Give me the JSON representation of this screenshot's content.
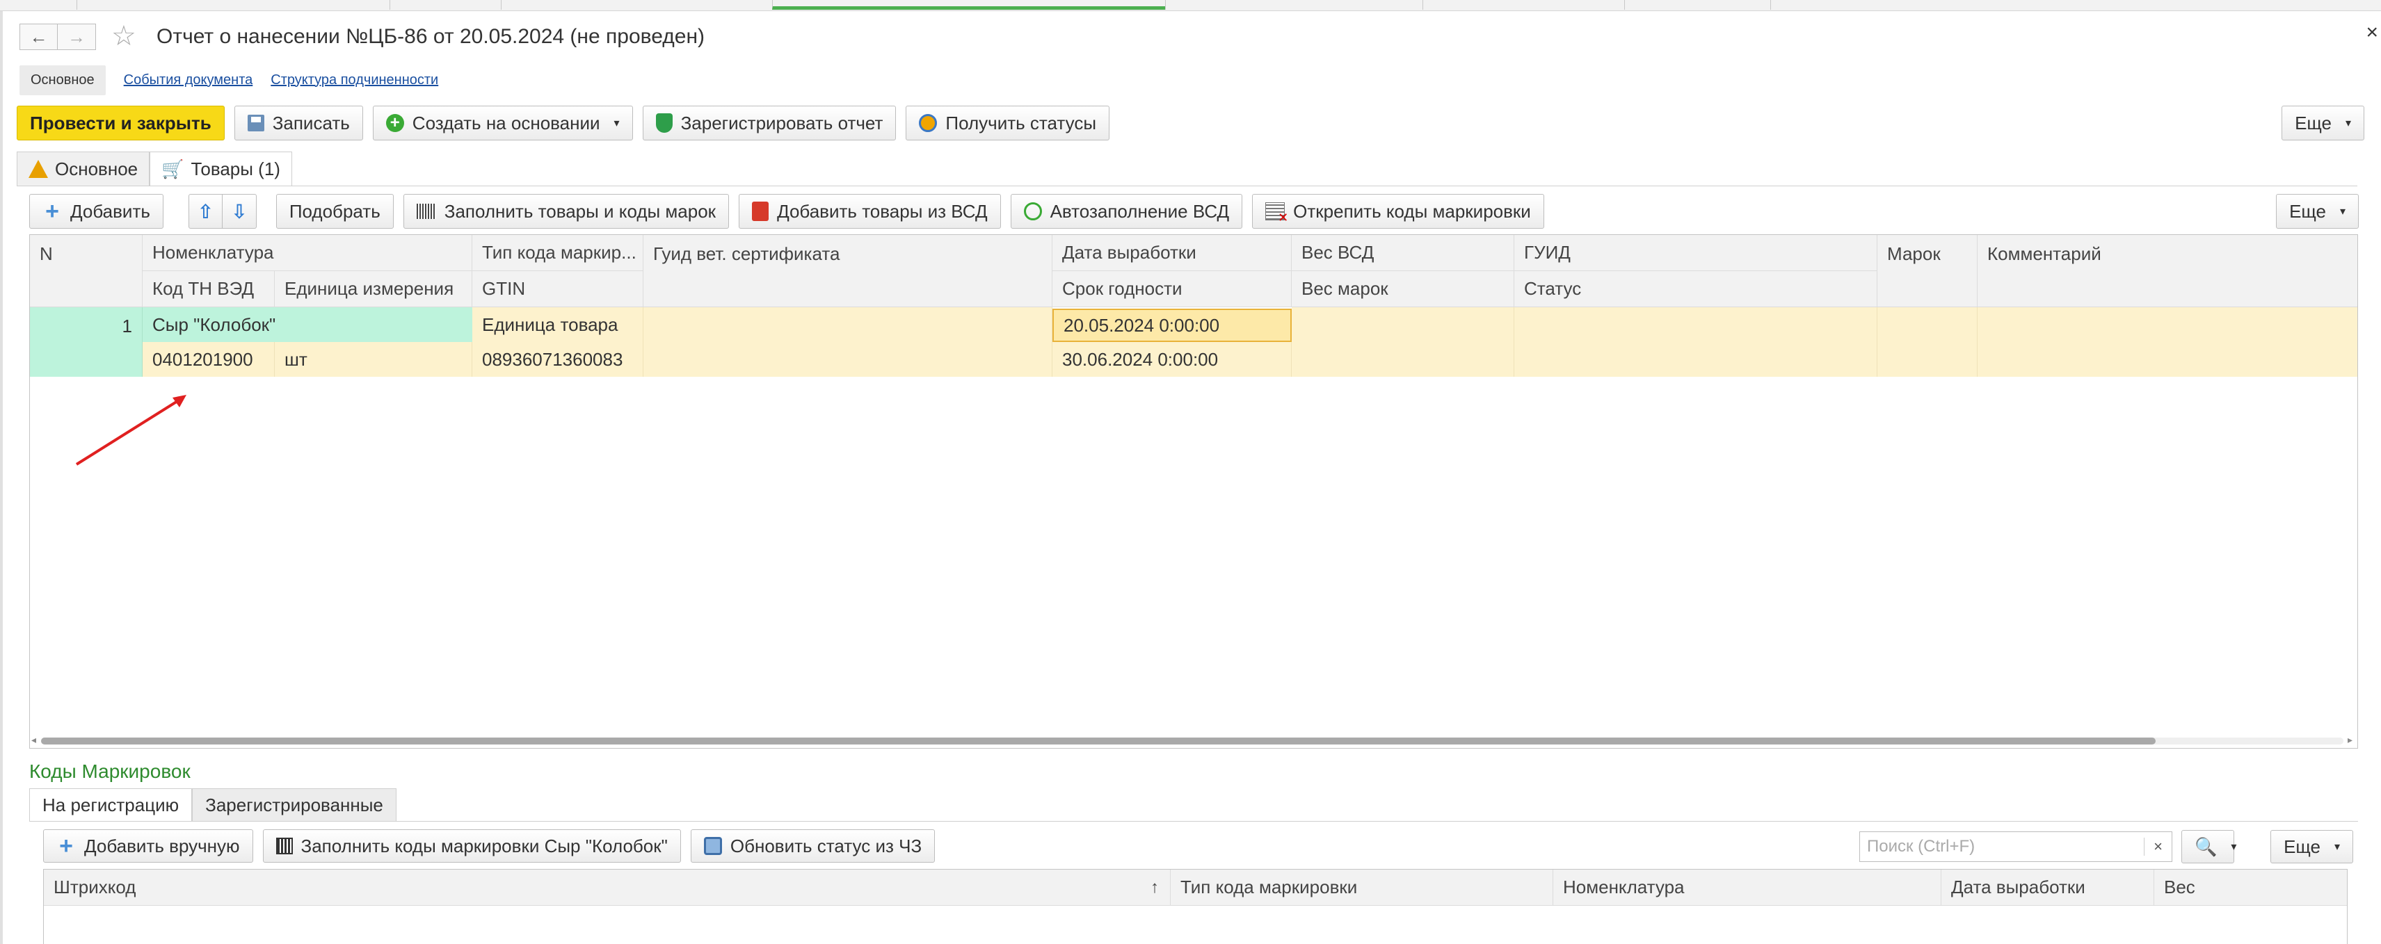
{
  "header": {
    "nav_back": "←",
    "nav_forward": "→",
    "title": "Отчет о нанесении №ЦБ-86 от 20.05.2024 (не проведен)",
    "close": "×"
  },
  "sections": {
    "current": "Основное",
    "links": [
      "События документа",
      "Структура подчиненности"
    ]
  },
  "commands": {
    "post_close": "Провести и закрыть",
    "save": "Записать",
    "create_based": "Создать на основании",
    "register_report": "Зарегистрировать отчет",
    "get_statuses": "Получить статусы",
    "more": "Еще"
  },
  "form_tabs": [
    "Основное",
    "Товары (1)"
  ],
  "goods_toolbar": {
    "add": "Добавить",
    "pick": "Подобрать",
    "fill_goods_codes": "Заполнить товары и коды марок",
    "add_from_vsd": "Добавить товары из ВСД",
    "autofill_vsd": "Автозаполнение ВСД",
    "unpin_codes": "Открепить коды маркировки",
    "more": "Еще"
  },
  "goods_table": {
    "headers_top": [
      "N",
      "Номенклатура",
      "Тип кода маркир...",
      "Гуид вет. сертификата",
      "Дата выработки",
      "Вес ВСД",
      "ГУИД",
      "Марок",
      "Комментарий"
    ],
    "headers_bottom": [
      "Код ТН ВЭД",
      "Единица измерения",
      "GTIN",
      "Срок годности",
      "Вес марок",
      "Статус"
    ],
    "row": {
      "n": "1",
      "nomenclature": "Сыр \"Колобок\"",
      "code_type": "Единица товара",
      "vet_guid": "",
      "production_date": "20.05.2024 0:00:00",
      "weight_vsd": "",
      "guid": "",
      "marks": "",
      "comment": "",
      "tnved": "0401201900",
      "unit": "шт",
      "gtin": "08936071360083",
      "expiry": "30.06.2024 0:00:00",
      "weight_marks": "",
      "status": ""
    }
  },
  "marking": {
    "title": "Коды Маркировок",
    "tabs": [
      "На регистрацию",
      "Зарегистрированные"
    ],
    "add_manual": "Добавить вручную",
    "fill_codes": "Заполнить коды маркировки Сыр \"Колобок\"",
    "update_status": "Обновить статус из ЧЗ",
    "search_placeholder": "Поиск (Ctrl+F)",
    "search_clear": "×",
    "more": "Еще",
    "headers": [
      "Штрихкод",
      "Тип кода маркировки",
      "Номенклатура",
      "Дата выработки",
      "Вес"
    ],
    "sort_indicator": "↑"
  },
  "colors": {
    "primary_button": "#f7d917",
    "row_highlight": "#fdf2cd",
    "number_cell": "#bdf3dc",
    "section_title": "#2e8b2e",
    "annotation_arrow": "#e02020"
  }
}
